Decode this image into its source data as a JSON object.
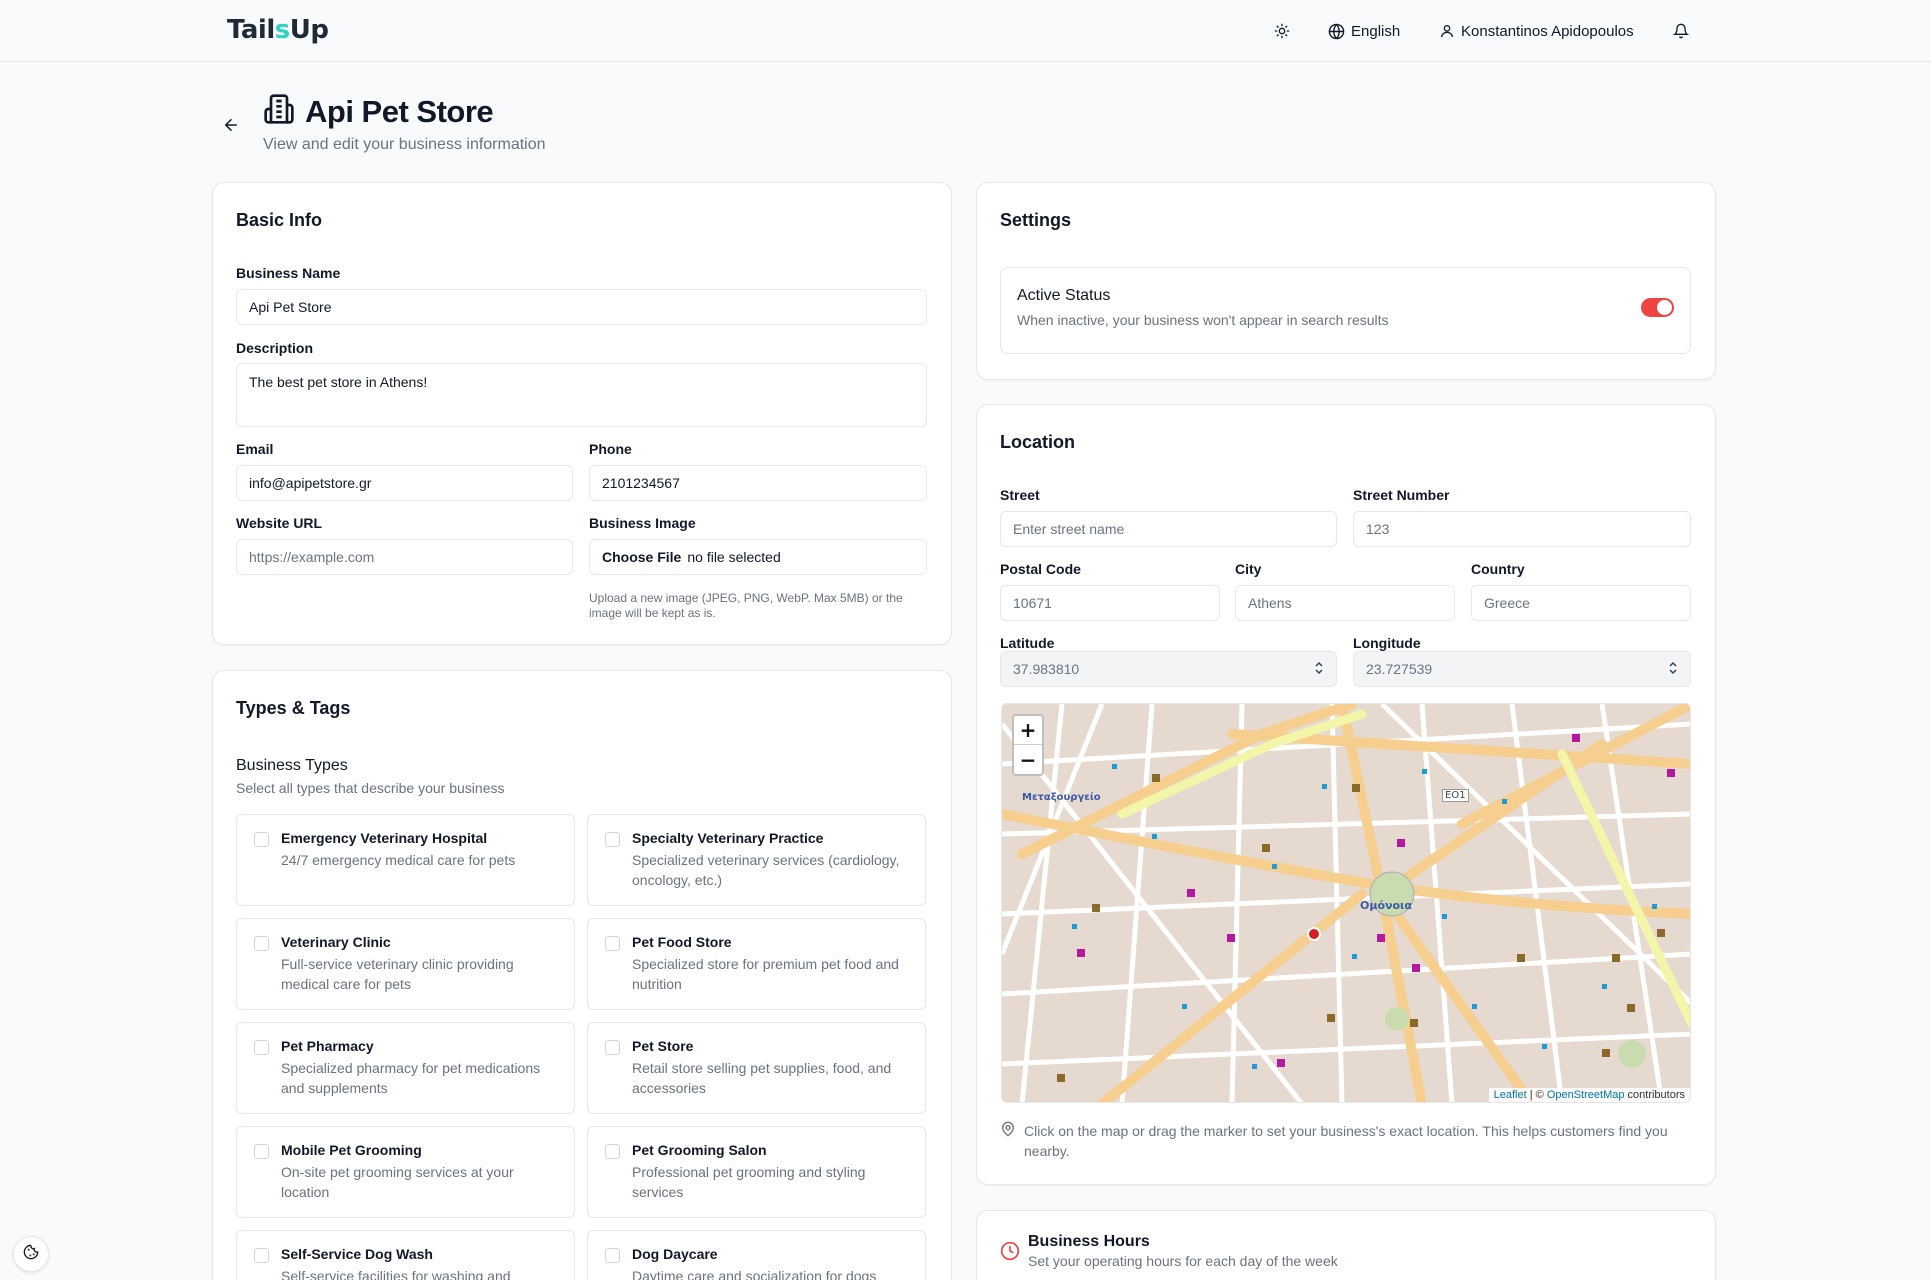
{
  "header": {
    "logo_left": "Tail",
    "logo_accent": "s",
    "logo_right": " Up",
    "language": "English",
    "user_name": "Konstantinos Apidopoulos"
  },
  "page": {
    "title": "Api Pet Store",
    "subtitle": "View and edit your business information"
  },
  "basic_info": {
    "heading": "Basic Info",
    "business_name_label": "Business Name",
    "business_name_value": "Api Pet Store",
    "description_label": "Description",
    "description_value": "The best pet store in Athens!",
    "email_label": "Email",
    "email_value": "info@apipetstore.gr",
    "phone_label": "Phone",
    "phone_value": "2101234567",
    "website_label": "Website URL",
    "website_placeholder": "https://example.com",
    "image_label": "Business Image",
    "choose_file": "Choose File",
    "no_file": "no file selected",
    "image_help": "Upload a new image (JPEG, PNG, WebP. Max 5MB) or the image will be kept as is."
  },
  "types_tags": {
    "heading": "Types & Tags",
    "business_types_title": "Business Types",
    "business_types_help": "Select all types that describe your business",
    "types": [
      {
        "name": "Emergency Veterinary Hospital",
        "desc": "24/7 emergency medical care for pets"
      },
      {
        "name": "Specialty Veterinary Practice",
        "desc": "Specialized veterinary services (cardiology, oncology, etc.)"
      },
      {
        "name": "Veterinary Clinic",
        "desc": "Full-service veterinary clinic providing medical care for pets"
      },
      {
        "name": "Pet Food Store",
        "desc": "Specialized store for premium pet food and nutrition"
      },
      {
        "name": "Pet Pharmacy",
        "desc": "Specialized pharmacy for pet medications and supplements"
      },
      {
        "name": "Pet Store",
        "desc": "Retail store selling pet supplies, food, and accessories"
      },
      {
        "name": "Mobile Pet Grooming",
        "desc": "On-site pet grooming services at your location"
      },
      {
        "name": "Pet Grooming Salon",
        "desc": "Professional pet grooming and styling services"
      },
      {
        "name": "Self-Service Dog Wash",
        "desc": "Self-service facilities for washing and"
      },
      {
        "name": "Dog Daycare",
        "desc": "Daytime care and socialization for dogs"
      }
    ]
  },
  "settings": {
    "heading": "Settings",
    "active_title": "Active Status",
    "active_help": "When inactive, your business won't appear in search results",
    "active": true
  },
  "location": {
    "heading": "Location",
    "street_label": "Street",
    "street_placeholder": "Enter street name",
    "number_label": "Street Number",
    "number_placeholder": "123",
    "postal_label": "Postal Code",
    "postal_placeholder": "10671",
    "city_label": "City",
    "city_placeholder": "Athens",
    "country_label": "Country",
    "country_placeholder": "Greece",
    "lat_label": "Latitude",
    "lat_value": "37.983810",
    "lng_label": "Longitude",
    "lng_value": "23.727539",
    "map_help": "Click on the map or drag the marker to set your business's exact location. This helps customers find you nearby.",
    "attribution_leaflet": "Leaflet",
    "attribution_sep": " | © ",
    "attribution_osm": "OpenStreetMap",
    "attribution_tail": " contributors",
    "map_labels": {
      "omonia": "Ομόνοια",
      "metaxourgeio": "Μεταξουργείο",
      "eo1": "ΕΟ1"
    }
  },
  "hours": {
    "heading": "Business Hours",
    "help": "Set your operating hours for each day of the week"
  },
  "colors": {
    "accent_red": "#ef4444",
    "logo_teal": "#2dd4bf"
  }
}
